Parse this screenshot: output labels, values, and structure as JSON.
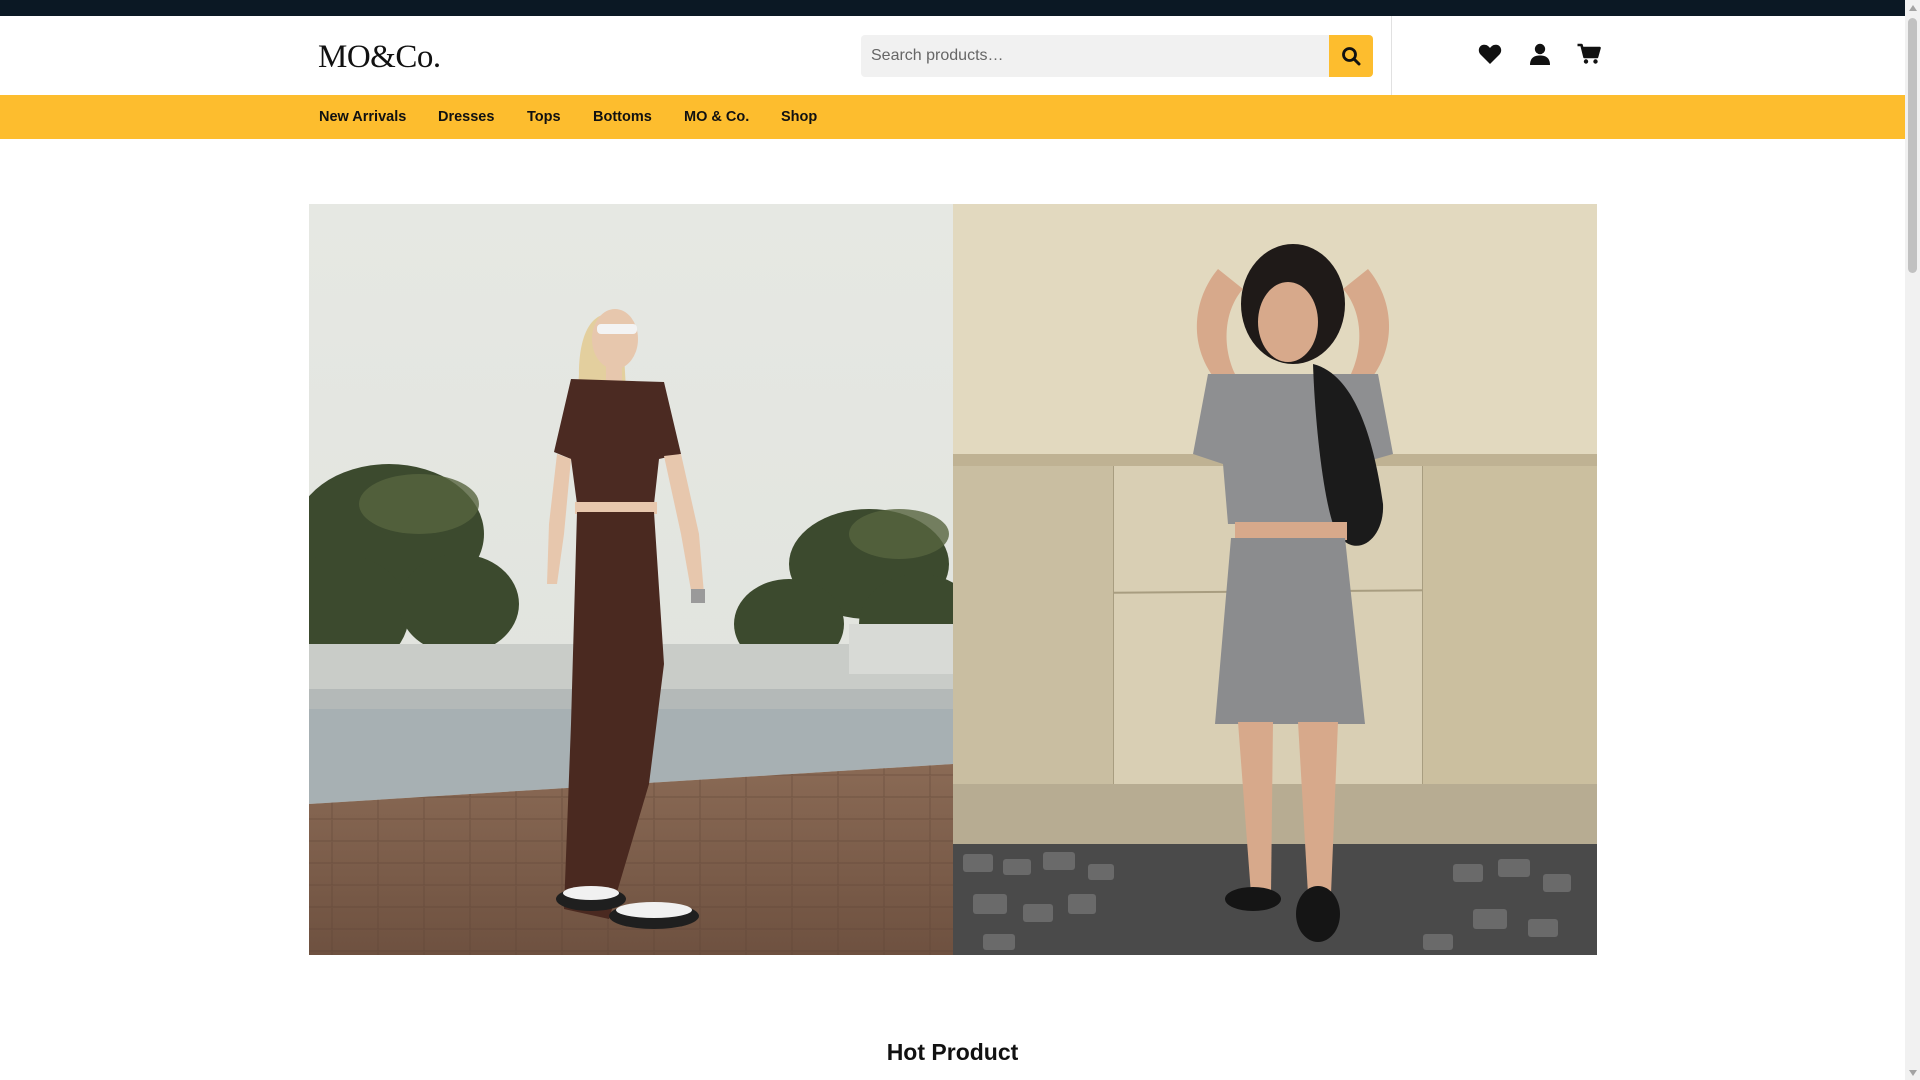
{
  "brand": {
    "logo_text": "MO&Co."
  },
  "search": {
    "placeholder": "Search products…",
    "value": "",
    "button_icon": "search-icon"
  },
  "header_icons": [
    "heart-icon",
    "user-icon",
    "cart-icon"
  ],
  "nav": {
    "items": [
      {
        "label": "New Arrivals"
      },
      {
        "label": "Dresses"
      },
      {
        "label": "Tops"
      },
      {
        "label": "Bottoms"
      },
      {
        "label": "MO & Co."
      },
      {
        "label": "Shop"
      }
    ]
  },
  "hero": {
    "panels": [
      {
        "description_icon": "model-brown-outfit-image"
      },
      {
        "description_icon": "model-grey-knit-set-image"
      }
    ]
  },
  "sections": {
    "hot_product_title": "Hot Product"
  },
  "colors": {
    "topbar": "#0b1824",
    "accent": "#fdbd2e",
    "search_bg": "#f1f1f1"
  }
}
